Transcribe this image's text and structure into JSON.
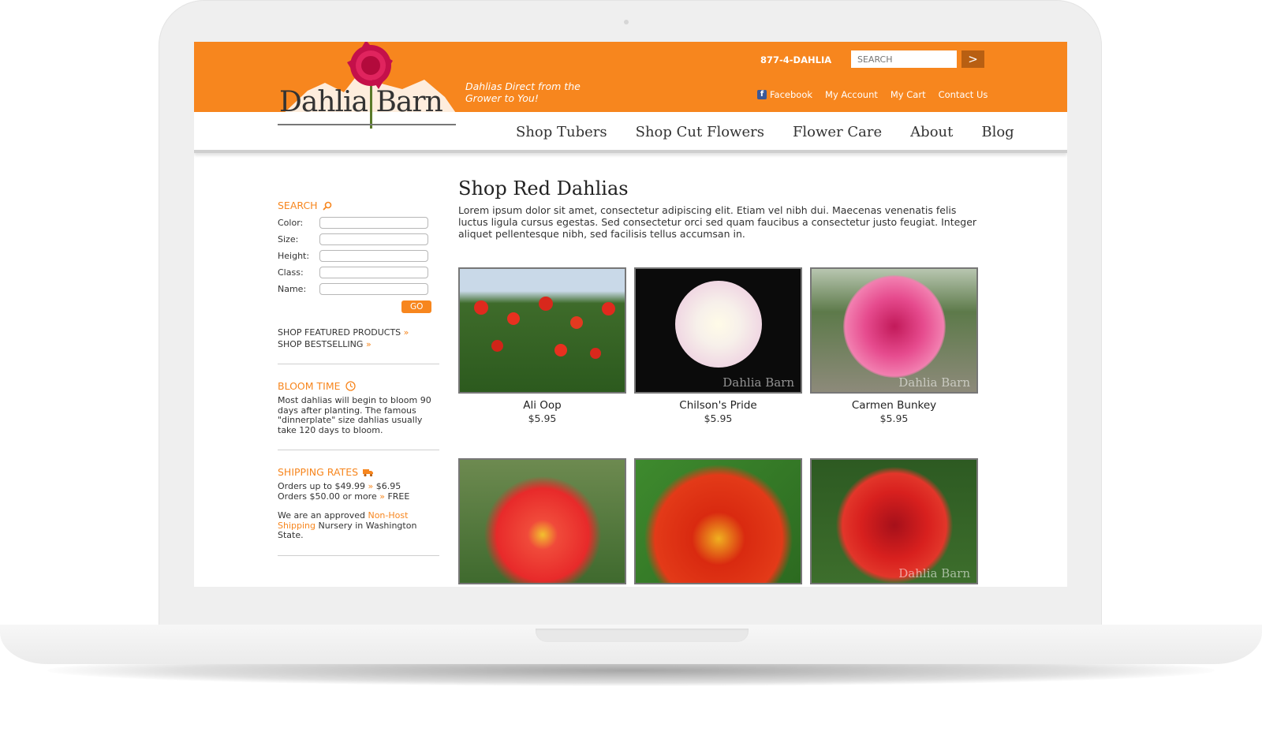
{
  "header": {
    "brand": "Dahlia Barn",
    "tagline": "Dahlias Direct from the Grower to You!",
    "phone": "877-4-DAHLIA",
    "search_placeholder": "SEARCH",
    "search_button": ">",
    "links": [
      {
        "label": "Facebook",
        "icon": "facebook-icon"
      },
      {
        "label": "My Account"
      },
      {
        "label": "My Cart"
      },
      {
        "label": "Contact Us"
      }
    ]
  },
  "nav": [
    "Shop Tubers",
    "Shop Cut Flowers",
    "Flower Care",
    "About",
    "Blog"
  ],
  "sidebar": {
    "search_heading": "SEARCH",
    "fields": [
      "Color:",
      "Size:",
      "Height:",
      "Class:",
      "Name:"
    ],
    "go_button": "GO",
    "shop_links": [
      "SHOP FEATURED PRODUCTS",
      "SHOP BESTSELLING"
    ],
    "link_arrow": "»",
    "bloom_heading": "BLOOM TIME",
    "bloom_text": "Most dahlias will begin to bloom 90 days after planting. The famous \"dinnerplate\" size dahlias usually take 120 days to bloom.",
    "shipping_heading": "SHIPPING RATES",
    "shipping_line1_a": "Orders up to $49.99",
    "shipping_line1_b": "$6.95",
    "shipping_line2_a": "Orders $50.00 or more",
    "shipping_line2_b": "FREE",
    "approved_a": "We are an approved",
    "approved_link": "Non-Host Shipping",
    "approved_b": "Nursery in Washington State."
  },
  "main": {
    "title": "Shop Red Dahlias",
    "intro": "Lorem ipsum dolor sit amet, consectetur adipiscing elit. Etiam vel nibh dui. Maecenas venenatis felis luctus ligula cursus egestas. Sed consectetur orci sed quam faucibus a consectetur justo feugiat. Integer aliquet pellentesque nibh, sed facilisis tellus accumsan in.",
    "watermark": "Dahlia Barn",
    "products": [
      {
        "name": "Ali Oop",
        "price": "$5.95"
      },
      {
        "name": "Chilson's Pride",
        "price": "$5.95"
      },
      {
        "name": "Carmen Bunkey",
        "price": "$5.95"
      }
    ]
  },
  "colors": {
    "accent": "#f7861e",
    "text": "#333333",
    "button_dark": "#b85f12"
  }
}
